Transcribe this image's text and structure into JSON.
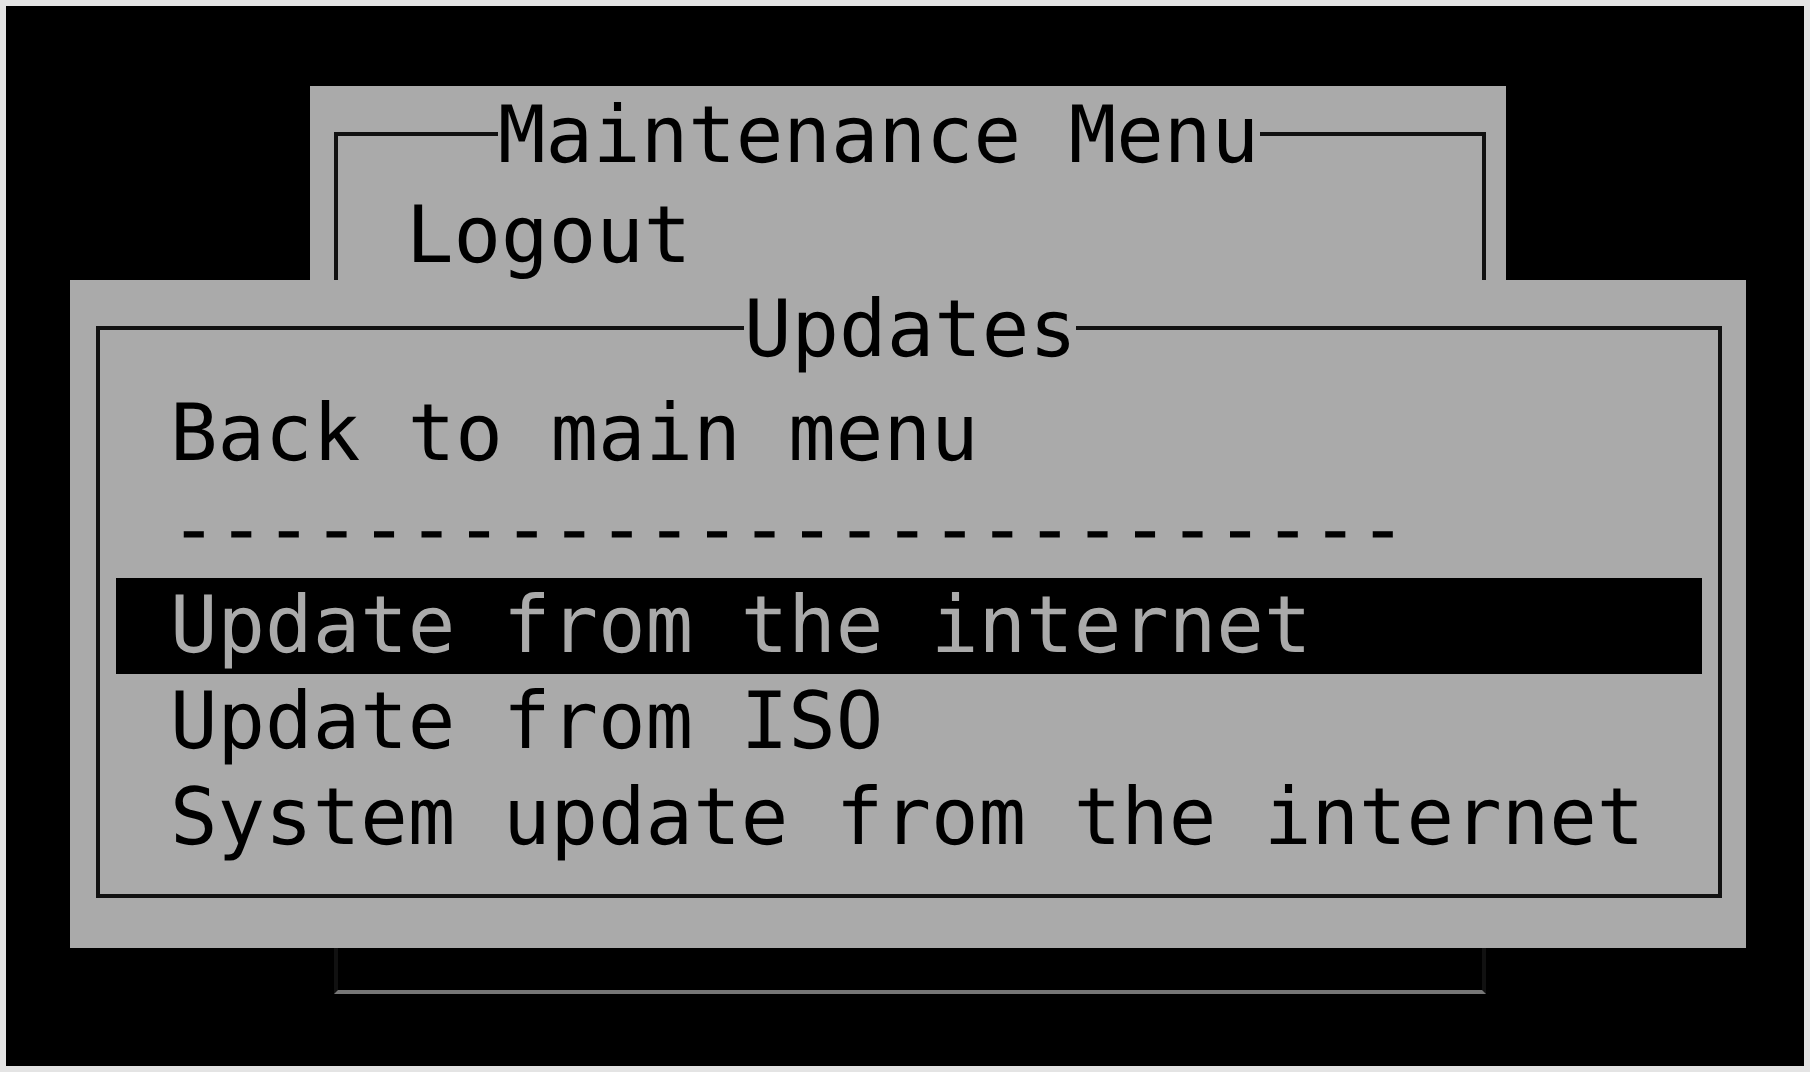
{
  "back_window": {
    "title": "Maintenance Menu",
    "items": [
      {
        "label": "Logout",
        "selected": false
      }
    ]
  },
  "dialog": {
    "title": "Updates",
    "items": [
      {
        "kind": "item",
        "label": "Back to main menu",
        "selected": false
      },
      {
        "kind": "separator",
        "label": "--------------------------"
      },
      {
        "kind": "item",
        "label": "Update from the internet",
        "selected": true
      },
      {
        "kind": "item",
        "label": "Update from ISO",
        "selected": false
      },
      {
        "kind": "item",
        "label": "System update from the internet",
        "selected": false
      }
    ]
  }
}
